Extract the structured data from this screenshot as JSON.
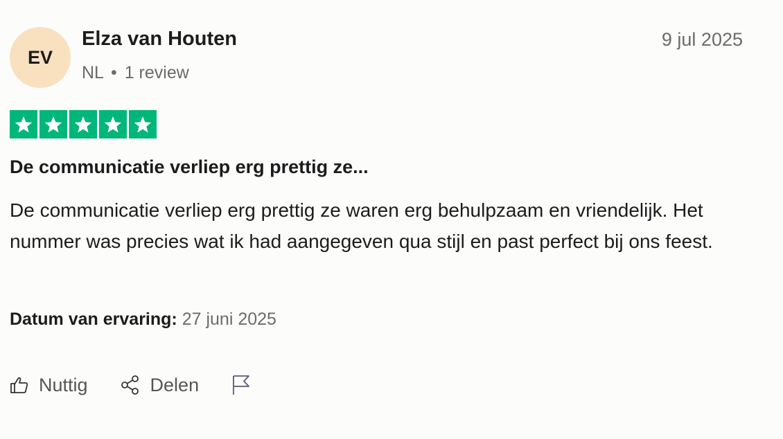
{
  "review": {
    "avatar_initials": "EV",
    "avatar_color": "#f9e0bf",
    "author_name": "Elza van Houten",
    "country": "NL",
    "separator": "•",
    "review_count": "1 review",
    "date": "9 jul 2025",
    "rating": 5,
    "rating_max": 5,
    "star_color": "#00b67a",
    "title": "De communicatie verliep erg prettig ze...",
    "text": "De communicatie verliep erg prettig ze waren erg behulpzaam en vriendelijk. Het nummer was precies wat ik had aangegeven qua stijl en past perfect bij ons feest.",
    "experience_label": "Datum van ervaring:",
    "experience_date": "27 juni 2025"
  },
  "actions": {
    "useful_label": "Nuttig",
    "useful_icon": "thumbs-up-icon",
    "share_label": "Delen",
    "share_icon": "share-icon",
    "report_icon": "flag-icon"
  }
}
